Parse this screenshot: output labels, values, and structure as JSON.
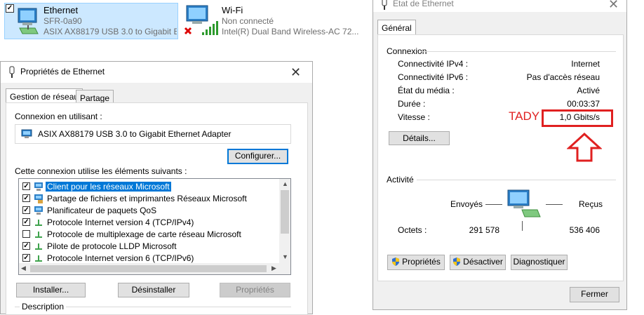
{
  "adapters": [
    {
      "name": "Ethernet",
      "network": "SFR-0a90",
      "device": "ASIX AX88179 USB 3.0 to Gigabit E...",
      "icon": "ethernet-adapter-icon",
      "selected": true
    },
    {
      "name": "Wi-Fi",
      "network": "Non connecté",
      "device": "Intel(R) Dual Band Wireless-AC 72...",
      "icon": "wifi-adapter-icon",
      "selected": false
    }
  ],
  "props": {
    "title": "Propriétés de Ethernet",
    "tabs": [
      "Gestion de réseau",
      "Partage"
    ],
    "connect_using_label": "Connexion en utilisant :",
    "adapter_name": "ASIX AX88179 USB 3.0 to Gigabit Ethernet Adapter",
    "configure": "Configurer...",
    "items_label": "Cette connexion utilise les éléments suivants :",
    "items": [
      {
        "label": "Client pour les réseaux Microsoft",
        "checked": true,
        "icon": "network-client-icon",
        "selected": true
      },
      {
        "label": "Partage de fichiers et imprimantes Réseaux Microsoft",
        "checked": true,
        "icon": "file-sharing-icon",
        "selected": false
      },
      {
        "label": "Planificateur de paquets QoS",
        "checked": true,
        "icon": "qos-icon",
        "selected": false
      },
      {
        "label": "Protocole Internet version 4 (TCP/IPv4)",
        "checked": true,
        "icon": "protocol-icon",
        "selected": false
      },
      {
        "label": "Protocole de multiplexage de carte réseau Microsoft",
        "checked": false,
        "icon": "protocol-icon",
        "selected": false
      },
      {
        "label": "Pilote de protocole LLDP Microsoft",
        "checked": true,
        "icon": "protocol-icon",
        "selected": false
      },
      {
        "label": "Protocole Internet version 6 (TCP/IPv6)",
        "checked": true,
        "icon": "protocol-icon",
        "selected": false
      }
    ],
    "install": "Installer...",
    "uninstall": "Désinstaller",
    "properties": "Propriétés",
    "description": "Description"
  },
  "status": {
    "title": "État de Ethernet",
    "tab": "Général",
    "connection_heading": "Connexion",
    "rows": [
      {
        "label": "Connectivité IPv4 :",
        "value": "Internet"
      },
      {
        "label": "Connectivité IPv6 :",
        "value": "Pas d'accès réseau"
      },
      {
        "label": "État du média :",
        "value": "Activé"
      },
      {
        "label": "Durée :",
        "value": "00:03:37"
      },
      {
        "label": "Vitesse :",
        "value": "1,0 Gbits/s"
      }
    ],
    "details": "Détails...",
    "activity_heading": "Activité",
    "sent": "Envoyés",
    "received": "Reçus",
    "bytes_label": "Octets :",
    "bytes_sent": "291 578",
    "bytes_received": "536 406",
    "btn_properties": "Propriétés",
    "btn_disable": "Désactiver",
    "btn_diagnose": "Diagnostiquer",
    "close": "Fermer"
  },
  "annotation": {
    "text": "TADY",
    "color": "#e02020"
  }
}
